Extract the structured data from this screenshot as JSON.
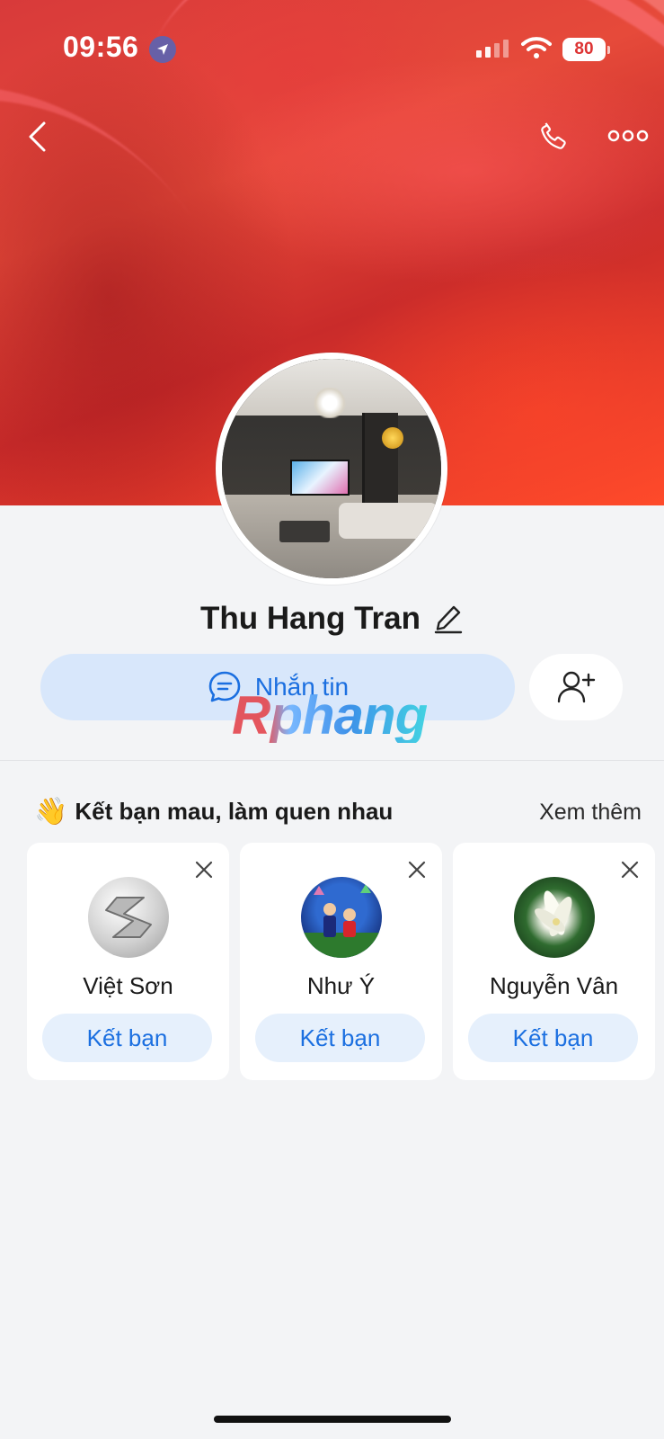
{
  "status_bar": {
    "time": "09:56",
    "battery": "80"
  },
  "profile": {
    "name": "Thu Hang Tran"
  },
  "actions": {
    "message_label": "Nhắn tin"
  },
  "watermark": "Rphang",
  "suggestions": {
    "title": "Kết bạn mau, làm quen nhau",
    "title_emoji": "👋",
    "see_more": "Xem thêm",
    "items": [
      {
        "name": "Việt Sơn",
        "button": "Kết bạn"
      },
      {
        "name": "Như Ý",
        "button": "Kết bạn"
      },
      {
        "name": "Nguyễn Vân",
        "button": "Kết bạn"
      }
    ]
  },
  "colors": {
    "accent": "#1b6fe0",
    "message_bg": "#d8e7fb",
    "page_bg": "#f3f4f6"
  }
}
